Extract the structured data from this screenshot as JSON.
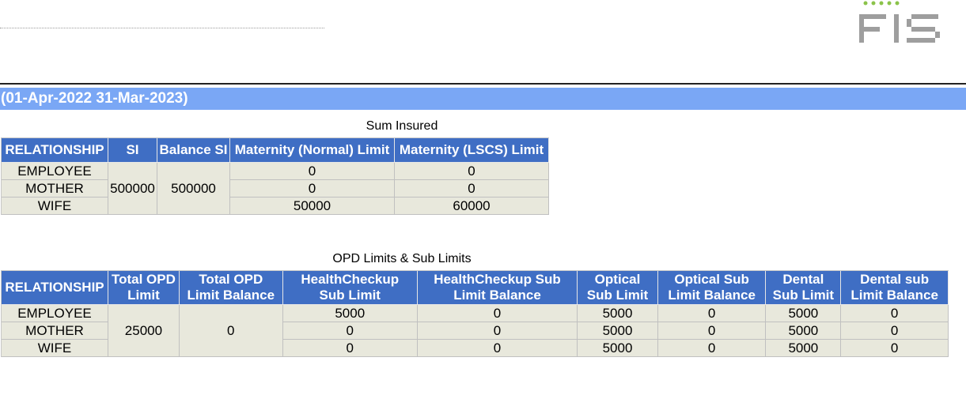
{
  "logo": {
    "text": "FIS"
  },
  "period": "(01-Apr-2022 31-Mar-2023)",
  "sum_insured": {
    "caption": "Sum Insured",
    "headers": [
      "RELATIONSHIP",
      "SI",
      "Balance SI",
      "Maternity (Normal) Limit",
      "Maternity (LSCS) Limit"
    ],
    "relationships": [
      "EMPLOYEE",
      "MOTHER",
      "WIFE"
    ],
    "si": "500000",
    "balance_si": "500000",
    "maternity_normal": [
      "0",
      "0",
      "50000"
    ],
    "maternity_lscs": [
      "0",
      "0",
      "60000"
    ]
  },
  "opd": {
    "caption": "OPD Limits & Sub Limits",
    "headers": [
      [
        "RELATIONSHIP"
      ],
      [
        "Total OPD",
        "Limit"
      ],
      [
        "Total OPD",
        "Limit Balance"
      ],
      [
        "HealthCheckup",
        "Sub Limit"
      ],
      [
        "HealthCheckup Sub",
        "Limit Balance"
      ],
      [
        "Optical",
        "Sub Limit"
      ],
      [
        "Optical Sub",
        "Limit Balance"
      ],
      [
        "Dental",
        "Sub Limit"
      ],
      [
        "Dental sub",
        "Limit Balance"
      ]
    ],
    "relationships": [
      "EMPLOYEE",
      "MOTHER",
      "WIFE"
    ],
    "total_opd_limit": "25000",
    "total_opd_limit_balance": "0",
    "healthcheckup_sub_limit": [
      "5000",
      "0",
      "0"
    ],
    "healthcheckup_sub_limit_balance": [
      "0",
      "0",
      "0"
    ],
    "optical_sub_limit": [
      "5000",
      "5000",
      "5000"
    ],
    "optical_sub_limit_balance": [
      "0",
      "0",
      "0"
    ],
    "dental_sub_limit": [
      "5000",
      "5000",
      "5000"
    ],
    "dental_sub_limit_balance": [
      "0",
      "0",
      "0"
    ]
  },
  "colors": {
    "header_blue": "#3f6ec4",
    "period_bar": "#7aa7f5",
    "cell_bg": "#e8e8dc",
    "logo_green": "#8bc34a",
    "logo_gray": "#9e9e9e"
  }
}
